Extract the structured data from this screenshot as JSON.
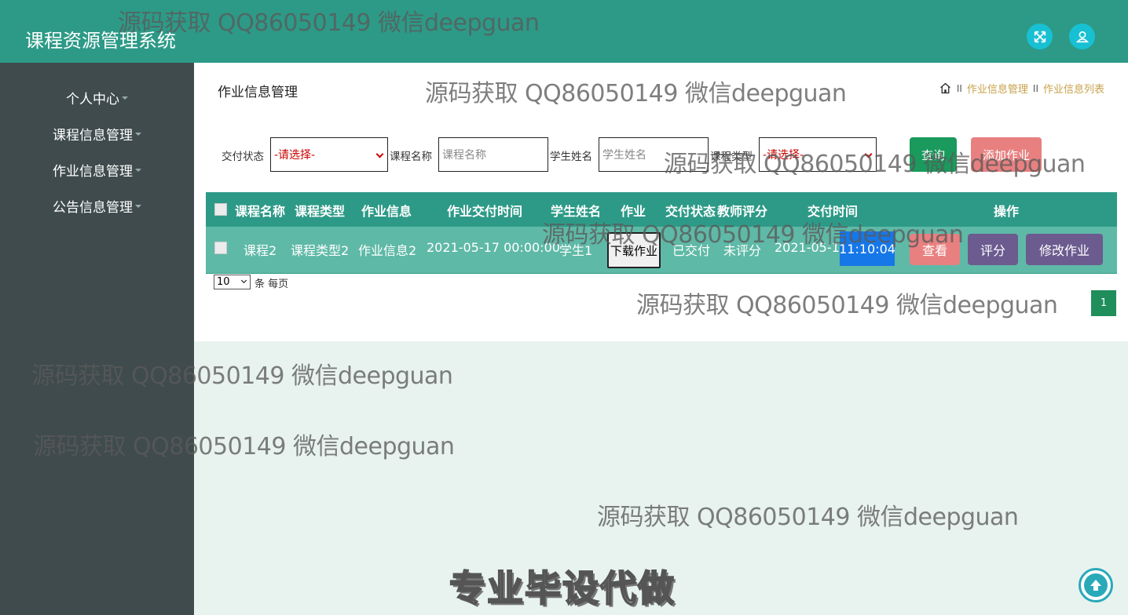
{
  "header": {
    "title": "课程资源管理系统",
    "icons": [
      "fullscreen-icon",
      "user-icon"
    ]
  },
  "sidebar": {
    "items": [
      {
        "label": "个人中心"
      },
      {
        "label": "课程信息管理"
      },
      {
        "label": "作业信息管理"
      },
      {
        "label": "公告信息管理"
      }
    ]
  },
  "main": {
    "heading": "作业信息管理",
    "breadcrumb": {
      "sep": "II",
      "items": [
        "作业信息管理",
        "作业信息列表"
      ]
    },
    "filters": {
      "status_label": "交付状态",
      "status_value": "-请选择-",
      "course_label": "课程名称",
      "course_placeholder": "课程名称",
      "student_label": "学生姓名",
      "student_placeholder": "学生姓名",
      "type_label": "课程类型",
      "type_value": "-请选择-",
      "search_button": "查询",
      "add_button": "添加作业"
    },
    "table": {
      "columns": [
        "课程名称",
        "课程类型",
        "作业信息",
        "作业交付时间",
        "学生姓名",
        "作业",
        "交付状态",
        "教师评分",
        "交付时间",
        "操作"
      ],
      "rows": [
        {
          "course": "课程2",
          "type": "课程类型2",
          "info": "作业信息2",
          "due": "2021-05-17 00:00:00",
          "student": "学生1",
          "file_button": "下载作业",
          "status": "已交付",
          "score": "未评分",
          "submit_date": "2021-05-15",
          "submit_time": "11:10:04",
          "actions": [
            "查看",
            "评分",
            "修改作业"
          ]
        }
      ]
    },
    "pagination": {
      "page_size": "10",
      "page_size_label": "条 每页",
      "current_page": "1"
    }
  },
  "overlay": {
    "watermark": "源码获取 QQ86050149 微信deepguan",
    "promo": "专业毕设代做"
  },
  "colors": {
    "header": "#2d9a87",
    "sidebar": "#3f4b4d",
    "search": "#1a9a5c",
    "add": "#e88080",
    "view": "#e88080",
    "score": "#6b5b8f",
    "edit": "#6b5b8f",
    "pager": "#1f8e5b"
  }
}
